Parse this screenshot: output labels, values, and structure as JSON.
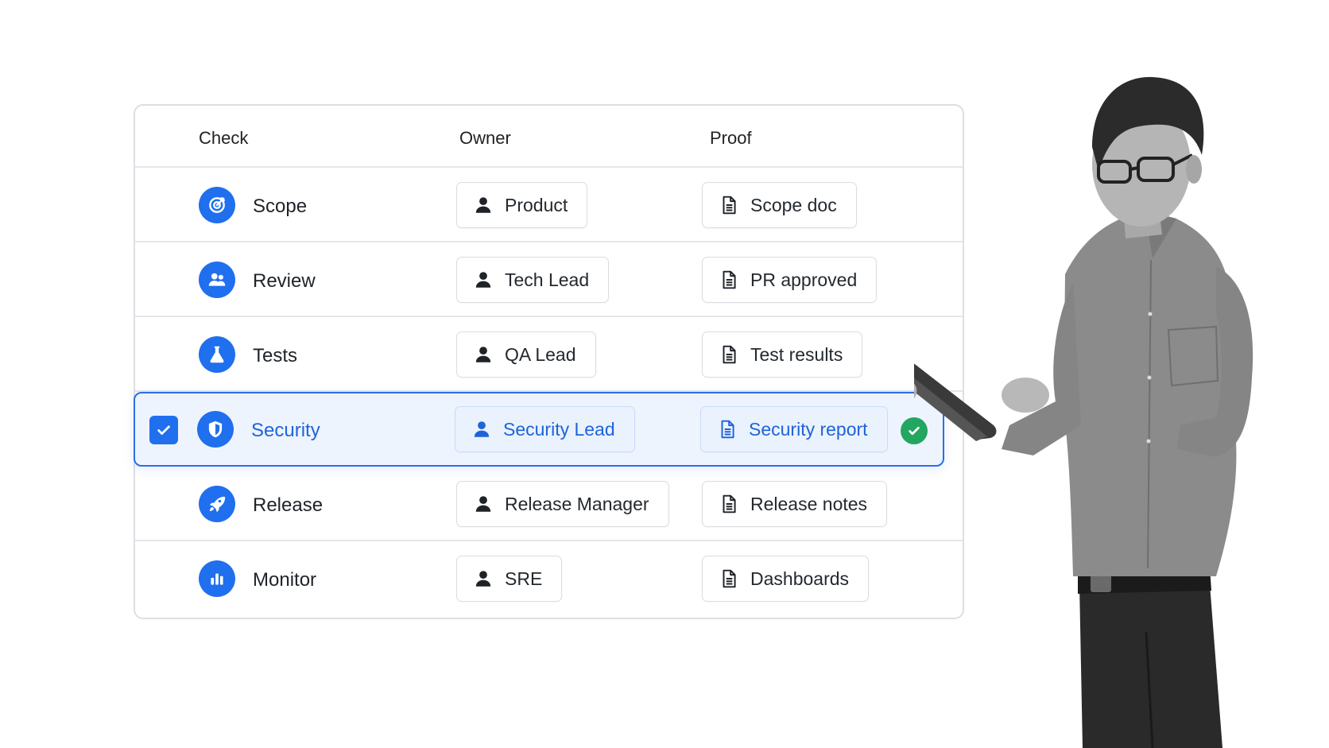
{
  "table": {
    "headers": {
      "check": "Check",
      "owner": "Owner",
      "proof": "Proof"
    },
    "rows": [
      {
        "check": "Scope",
        "icon": "target-icon",
        "owner": "Product",
        "proof": "Scope doc",
        "selected": false
      },
      {
        "check": "Review",
        "icon": "users-icon",
        "owner": "Tech Lead",
        "proof": "PR approved",
        "selected": false
      },
      {
        "check": "Tests",
        "icon": "flask-icon",
        "owner": "QA Lead",
        "proof": "Test results",
        "selected": false
      },
      {
        "check": "Security",
        "icon": "shield-icon",
        "owner": "Security Lead",
        "proof": "Security report",
        "selected": true
      },
      {
        "check": "Release",
        "icon": "rocket-icon",
        "owner": "Release Manager",
        "proof": "Release notes",
        "selected": false
      },
      {
        "check": "Monitor",
        "icon": "bar-chart-icon",
        "owner": "SRE",
        "proof": "Dashboards",
        "selected": false
      }
    ]
  },
  "colors": {
    "accent": "#1f6fee",
    "selected_bg": "#eef4fe",
    "success": "#22a660"
  }
}
